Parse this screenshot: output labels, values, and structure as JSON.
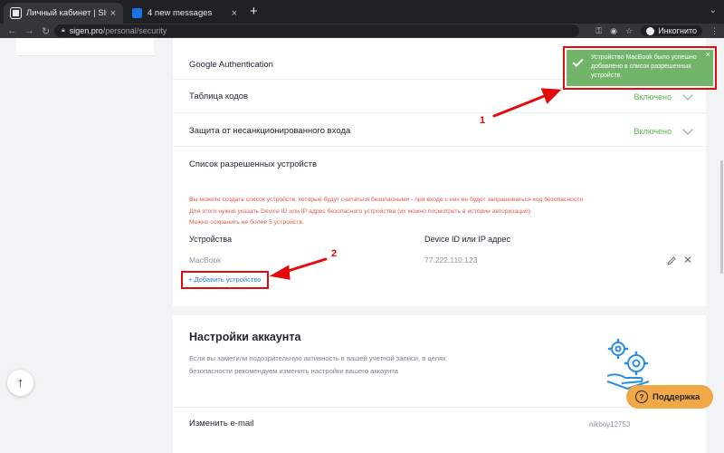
{
  "browser": {
    "tabs": [
      {
        "title": "Личный кабинет | SIGEN.pro",
        "close": "×"
      },
      {
        "title": "4 new messages",
        "close": "×"
      }
    ],
    "new_tab": "+",
    "url_domain": "sigen.pro",
    "url_path": "/personal/security",
    "profile_label": "Инкогнито"
  },
  "security": {
    "rows": [
      {
        "label": "Google Authentication",
        "status": ""
      },
      {
        "label": "Таблица кодов",
        "status": "Включено"
      },
      {
        "label": "Защита от несанкционированного входа",
        "status": "Включено"
      }
    ],
    "devices": {
      "title": "Список разрешенных устройств",
      "warning_lines": [
        "Вы можете создать список устройств, которые будут считаться безопасными - при входе с них не будет запрашиваться код безопасности.",
        "Для этого нужно указать Device ID или IP адрес безопасного устройства (их можно посмотреть в истории авторизаций)",
        "Можно сохранить не более 5 устройств."
      ],
      "col_devices": "Устройства",
      "col_id": "Device ID или IP адрес",
      "items": [
        {
          "name": "MacBook",
          "id": "77.222.110.123"
        }
      ],
      "add_label": "+ Добавить устройство"
    }
  },
  "account": {
    "title": "Настройки аккаунта",
    "desc_lines": [
      "Если вы заметили подозрительную активность в вашей учетной записи, в целях",
      "безопасности рекомендуем изменить настройки вашего аккаунта"
    ],
    "email_label": "Изменить e-mail",
    "email_value": "nikboy12753"
  },
  "toast": {
    "message": "Устройство MacBook было успешно добавлено в список разрешенных устройств.",
    "close": "×"
  },
  "support_label": "Поддержка",
  "scroll_top_glyph": "↑",
  "annotations": {
    "n1": "1",
    "n2": "2"
  },
  "colors": {
    "enabled_green": "#57b44d",
    "warning_red": "#e2594e",
    "link_blue": "#2f7ee6",
    "toast_green": "#72b56a",
    "support_orange": "#f1a948",
    "annotation_red": "#e20a0a"
  }
}
